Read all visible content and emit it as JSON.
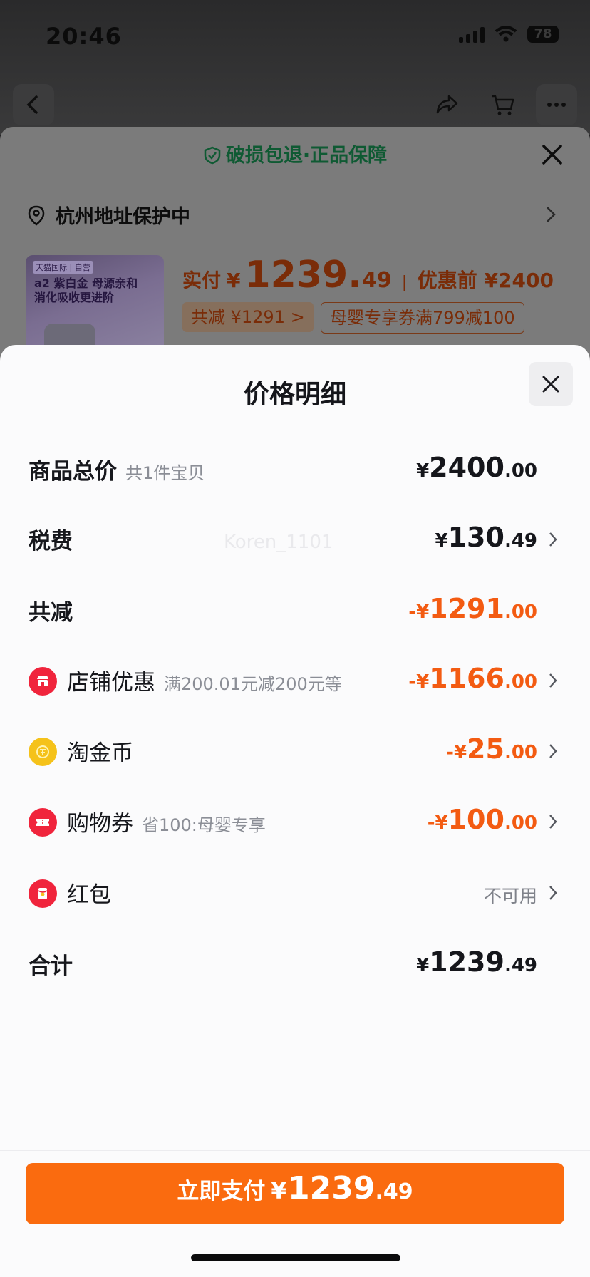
{
  "status_bar": {
    "time": "20:46",
    "battery": "78"
  },
  "background": {
    "guarantee_text": "破损包退·正品保障",
    "address_text": "杭州地址保护中",
    "product_thumb": {
      "brand_tag": "天猫国际 | 自营",
      "title": "a2 紫白金 母源亲和\n消化吸收更进阶"
    },
    "price_label": "实付",
    "price_yen": "¥",
    "price_integer": "1239.",
    "price_decimal": "49",
    "price_separator": "|",
    "price_before": "优惠前 ¥2400",
    "discount_chip": "共减 ¥1291 >",
    "coupon_chip": "母婴专享券满799减100"
  },
  "modal": {
    "title": "价格明细",
    "watermark": "Koren_1101",
    "rows": [
      {
        "label": "商品总价",
        "sub": "共1件宝贝",
        "yen": "¥",
        "int": "2400",
        "dec": ".00"
      },
      {
        "label": "税费",
        "yen": "¥",
        "int": "130",
        "dec": ".49"
      },
      {
        "label": "共减",
        "yen": "-¥",
        "int": "1291",
        "dec": ".00"
      },
      {
        "label": "店铺优惠",
        "sub": "满200.01元减200元等",
        "yen": "-¥",
        "int": "1166",
        "dec": ".00",
        "icon": "shop-icon"
      },
      {
        "label": "淘金币",
        "yen": "-¥",
        "int": "25",
        "dec": ".00",
        "icon": "coin-icon"
      },
      {
        "label": "购物券",
        "sub": "省100:母婴专享",
        "yen": "-¥",
        "int": "100",
        "dec": ".00",
        "icon": "ticket-icon"
      },
      {
        "label": "红包",
        "status": "不可用",
        "icon": "red-envelope-icon"
      },
      {
        "label": "合计",
        "yen": "¥",
        "int": "1239",
        "dec": ".49"
      }
    ],
    "pay_button": {
      "label": "立即支付",
      "yen": "¥",
      "int": "1239",
      "dec": ".49"
    }
  },
  "colors": {
    "accent": "#fa6b0f",
    "discount": "#f35b12",
    "icon_red": "#f0243c",
    "coin_gold": "#f5c21a"
  }
}
